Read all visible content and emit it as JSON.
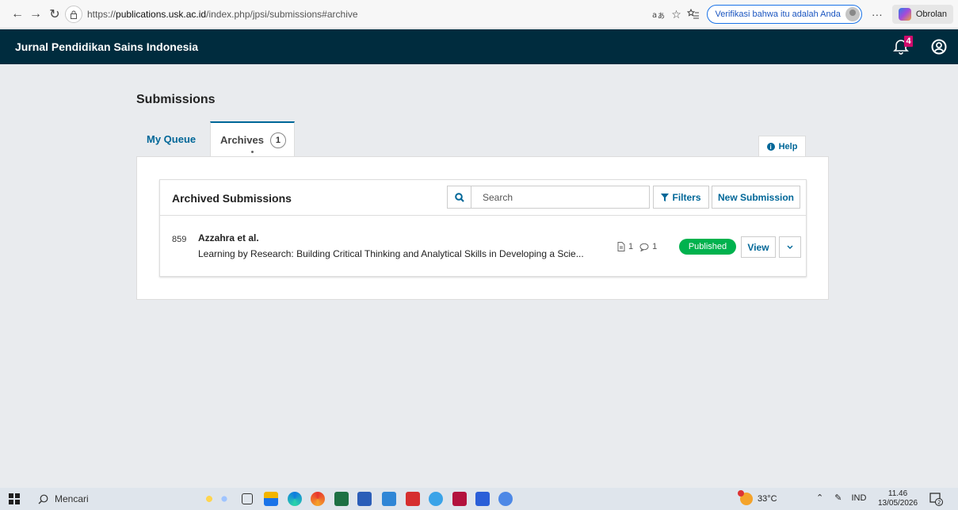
{
  "browser": {
    "url_prefix": "https://",
    "url_host": "publications.usk.ac.id",
    "url_path": "/index.php/jpsi/submissions#archive",
    "verify_label": "Verifikasi bahwa itu adalah Anda",
    "copilot_label": "Obrolan",
    "more_label": "···"
  },
  "header": {
    "journal_title": "Jurnal Pendidikan Sains Indonesia",
    "notification_count": "4"
  },
  "page": {
    "title": "Submissions",
    "tabs": [
      {
        "label": "My Queue"
      },
      {
        "label": "Archives",
        "count": "1"
      }
    ],
    "help_label": "Help"
  },
  "list": {
    "title": "Archived Submissions",
    "search_placeholder": "Search",
    "filters_label": "Filters",
    "new_submission_label": "New Submission",
    "items": [
      {
        "id": "859",
        "authors": "Azzahra et al.",
        "title": "Learning by Research: Building Critical Thinking and Analytical Skills in Developing a Scie...",
        "files": "1",
        "discussions": "1",
        "status": "Published",
        "view_label": "View"
      }
    ]
  },
  "taskbar": {
    "search_label": "Mencari",
    "temperature": "33°C",
    "language": "IND",
    "time": "11.46",
    "date": "13/05/2026",
    "notif_count": "2"
  },
  "colors": {
    "header_bg": "#002c3e",
    "accent": "#006798",
    "published": "#00b24e",
    "badge": "#d00a6c"
  }
}
